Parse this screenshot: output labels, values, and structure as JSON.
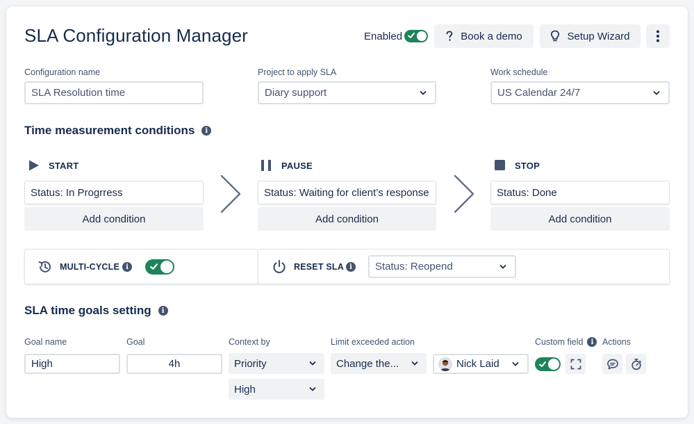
{
  "header": {
    "title": "SLA Configuration Manager",
    "enabled_label": "Enabled",
    "enabled": true,
    "book_demo_label": "Book a demo",
    "setup_wizard_label": "Setup Wizard"
  },
  "config": {
    "name_label": "Configuration name",
    "name_value": "SLA Resolution time",
    "project_label": "Project to apply SLA",
    "project_value": "Diary support",
    "schedule_label": "Work schedule",
    "schedule_value": "US Calendar 24/7"
  },
  "conditions": {
    "title": "Time measurement conditions",
    "start": {
      "label": "START",
      "status": "Status: In Progrress",
      "add_label": "Add condition"
    },
    "pause": {
      "label": "PAUSE",
      "status": "Status: Waiting for client’s response",
      "add_label": "Add condition"
    },
    "stop": {
      "label": "STOP",
      "status": "Status: Done",
      "add_label": "Add condition"
    }
  },
  "options": {
    "multicycle_label": "MULTI-CYCLE",
    "multicycle_enabled": true,
    "reset_label": "RESET SLA",
    "reset_value": "Status: Reopend"
  },
  "goals": {
    "title": "SLA time goals setting",
    "columns": {
      "goal_name": "Goal name",
      "goal": "Goal",
      "context": "Context by",
      "limit_action": "Limit exceeded action",
      "custom_field": "Custom field",
      "actions": "Actions"
    },
    "row": {
      "goal_name": "High",
      "goal": "4h",
      "context_by": "Priority",
      "context_value": "High",
      "limit_action": "Change the...",
      "assignee": "Nick Laid",
      "custom_field_enabled": true
    }
  },
  "colors": {
    "accent_green": "#1f845a",
    "text_primary": "#172b4d",
    "text_secondary": "#44546f",
    "button_bg": "#f1f2f4"
  }
}
